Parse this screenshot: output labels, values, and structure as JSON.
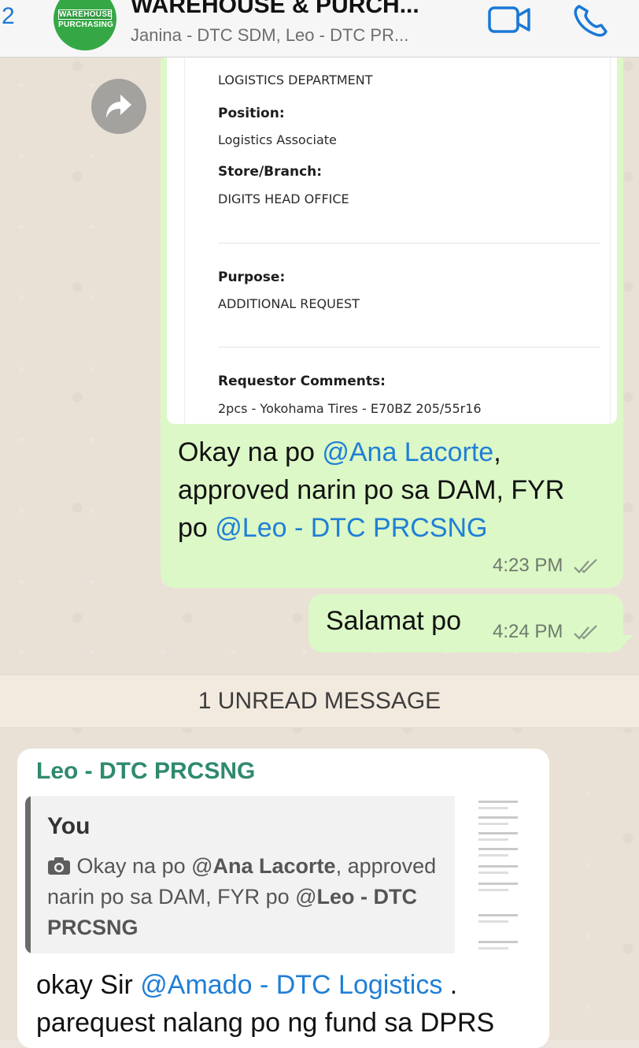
{
  "header": {
    "back_count": "2",
    "title": "WAREHOUSE & PURCH...",
    "subtitle": "Janina - DTC SDM, Leo - DTC PR...",
    "avatar_line1": "WAREHOUSE",
    "avatar_line2": "PURCHASING"
  },
  "document": {
    "department_value": "LOGISTICS DEPARTMENT",
    "position_label": "Position:",
    "position_value": "Logistics Associate",
    "branch_label": "Store/Branch:",
    "branch_value": "DIGITS HEAD OFFICE",
    "purpose_label": "Purpose:",
    "purpose_value": "ADDITIONAL REQUEST",
    "comments_label": "Requestor Comments:",
    "comments_value": "2pcs - Yokohama Tires - E70BZ 205/55r16"
  },
  "outgoing_1": {
    "part1": "Okay na po ",
    "mention1": "@Ana Lacorte",
    "part2": ",",
    "part3": "approved narin po sa DAM, FYR",
    "part4": "po ",
    "mention2": "@Leo - DTC PRCSNG",
    "time": "4:23 PM"
  },
  "outgoing_2": {
    "text": "Salamat po",
    "time": "4:24 PM"
  },
  "unread_label": "1 UNREAD MESSAGE",
  "incoming": {
    "sender": "Leo - DTC PRCSNG",
    "quote_author": "You",
    "quote_part1": "Okay na po @",
    "quote_mention1": "Ana Lacorte",
    "quote_part2": ", approved narin po sa DAM, FYR po @",
    "quote_mention2": "Leo - DTC PRCSNG",
    "reply_part1": "okay Sir ",
    "reply_mention": "@Amado - DTC Logistics",
    "reply_part2": " .",
    "reply_line2": "parequest nalang po ng fund sa DPRS"
  },
  "colors": {
    "outgoing_bubble": "#dcf8c6",
    "incoming_bubble": "#ffffff",
    "mention": "#1f7fd6",
    "sender": "#2f8a6f",
    "ios_blue": "#1a78d6"
  },
  "icons": {
    "video": "video-camera-icon",
    "phone": "phone-icon",
    "forward": "forward-arrow-icon",
    "camera": "camera-icon",
    "ticks": "double-check-icon"
  }
}
